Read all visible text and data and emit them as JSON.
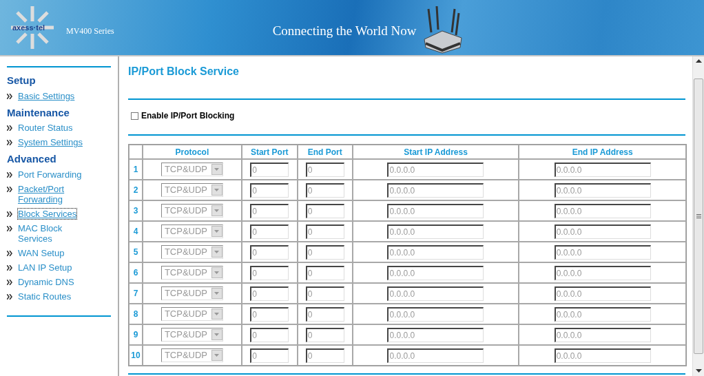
{
  "header": {
    "series": "MV400 Series",
    "slogan": "Connecting the World Now",
    "logo": "axess·tel"
  },
  "sidebar": {
    "sections": [
      {
        "title": "Setup",
        "items": [
          {
            "label": "Basic Settings",
            "visited": true,
            "selected": false
          }
        ]
      },
      {
        "title": "Maintenance",
        "items": [
          {
            "label": "Router Status",
            "visited": false,
            "selected": false
          },
          {
            "label": "System Settings",
            "visited": true,
            "selected": false
          }
        ]
      },
      {
        "title": "Advanced",
        "items": [
          {
            "label": "Port Forwarding",
            "visited": false,
            "selected": false
          },
          {
            "label": "Packet/Port Forwarding",
            "visited": true,
            "selected": false
          },
          {
            "label": "Block Services",
            "visited": true,
            "selected": true
          },
          {
            "label": "MAC Block Services",
            "visited": false,
            "selected": false
          },
          {
            "label": "WAN Setup",
            "visited": false,
            "selected": false
          },
          {
            "label": "LAN IP Setup",
            "visited": false,
            "selected": false
          },
          {
            "label": "Dynamic DNS",
            "visited": false,
            "selected": false
          },
          {
            "label": "Static Routes",
            "visited": false,
            "selected": false
          }
        ]
      }
    ]
  },
  "page": {
    "title": "IP/Port Block Service",
    "enable": {
      "label": "Enable IP/Port Blocking",
      "checked": false
    }
  },
  "table": {
    "columns": [
      "Protocol",
      "Start Port",
      "End Port",
      "Start IP Address",
      "End IP Address"
    ],
    "rows": [
      {
        "index": "1",
        "protocol": "TCP&UDP",
        "start_port": "0",
        "end_port": "0",
        "start_ip": "0.0.0.0",
        "end_ip": "0.0.0.0",
        "disabled": true
      },
      {
        "index": "2",
        "protocol": "TCP&UDP",
        "start_port": "0",
        "end_port": "0",
        "start_ip": "0.0.0.0",
        "end_ip": "0.0.0.0",
        "disabled": true
      },
      {
        "index": "3",
        "protocol": "TCP&UDP",
        "start_port": "0",
        "end_port": "0",
        "start_ip": "0.0.0.0",
        "end_ip": "0.0.0.0",
        "disabled": true
      },
      {
        "index": "4",
        "protocol": "TCP&UDP",
        "start_port": "0",
        "end_port": "0",
        "start_ip": "0.0.0.0",
        "end_ip": "0.0.0.0",
        "disabled": true
      },
      {
        "index": "5",
        "protocol": "TCP&UDP",
        "start_port": "0",
        "end_port": "0",
        "start_ip": "0.0.0.0",
        "end_ip": "0.0.0.0",
        "disabled": true
      },
      {
        "index": "6",
        "protocol": "TCP&UDP",
        "start_port": "0",
        "end_port": "0",
        "start_ip": "0.0.0.0",
        "end_ip": "0.0.0.0",
        "disabled": true
      },
      {
        "index": "7",
        "protocol": "TCP&UDP",
        "start_port": "0",
        "end_port": "0",
        "start_ip": "0.0.0.0",
        "end_ip": "0.0.0.0",
        "disabled": true
      },
      {
        "index": "8",
        "protocol": "TCP&UDP",
        "start_port": "0",
        "end_port": "0",
        "start_ip": "0.0.0.0",
        "end_ip": "0.0.0.0",
        "disabled": true
      },
      {
        "index": "9",
        "protocol": "TCP&UDP",
        "start_port": "0",
        "end_port": "0",
        "start_ip": "0.0.0.0",
        "end_ip": "0.0.0.0",
        "disabled": true
      },
      {
        "index": "10",
        "protocol": "TCP&UDP",
        "start_port": "0",
        "end_port": "0",
        "start_ip": "0.0.0.0",
        "end_ip": "0.0.0.0",
        "disabled": true
      }
    ]
  }
}
